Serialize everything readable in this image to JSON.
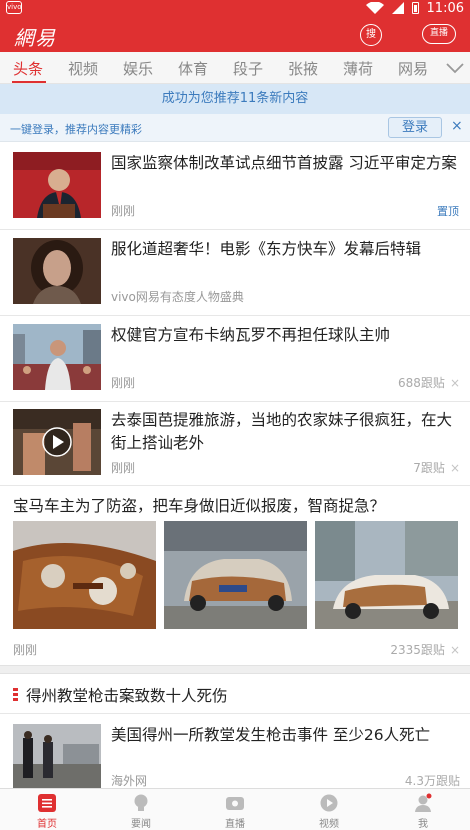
{
  "status": {
    "app_icon": "vivo",
    "time": "11:06"
  },
  "header": {
    "logo": "網易",
    "search_label": "搜",
    "live_label": "直播"
  },
  "tabs": [
    "头条",
    "视频",
    "娱乐",
    "体育",
    "段子",
    "张掖",
    "薄荷",
    "网易"
  ],
  "banner": "成功为您推荐11条新内容",
  "login": {
    "hint": "一键登录，推荐内容更精彩",
    "button": "登录",
    "close": "×"
  },
  "news": [
    {
      "title": "国家监察体制改革试点细节首披露 习近平审定方案",
      "source": "刚刚",
      "badge": "置顶"
    },
    {
      "title": "服化道超奢华！电影《东方快车》发幕后特辑",
      "source": "vivo网易有态度人物盛典"
    },
    {
      "title": "权健官方宣布卡纳瓦罗不再担任球队主帅",
      "source": "刚刚",
      "comments": "688跟贴"
    },
    {
      "title": "去泰国芭提雅旅游，当地的农家妹子很疯狂，在大街上搭讪老外",
      "source": "刚刚",
      "comments": "7跟贴"
    }
  ],
  "gallery": {
    "title": "宝马车主为了防盗，把车身做旧近似报废，智商捉急？",
    "source": "刚刚",
    "comments": "2335跟贴"
  },
  "topic": {
    "label": "得州教堂枪击案致数十人死伤"
  },
  "topic_news": {
    "title": "美国得州一所教堂发生枪击事件 至少26人死亡",
    "source": "海外网",
    "comments": "4.3万跟贴"
  },
  "bottom_nav": [
    "首页",
    "要闻",
    "直播",
    "视频",
    "我"
  ],
  "colors": {
    "brand": "#df3031",
    "link": "#3c7bbd"
  }
}
